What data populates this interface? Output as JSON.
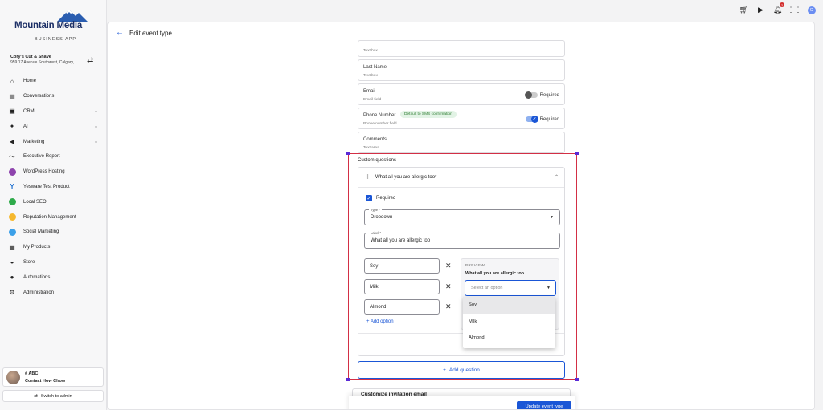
{
  "brand": {
    "name": "Mountain Media",
    "subtitle": "BUSINESS APP"
  },
  "business": {
    "name": "Cory's Cut & Shave",
    "address": "959 17 Avenue Southwest, Calgary, ..."
  },
  "nav": [
    {
      "label": "Home",
      "icon": "home-icon"
    },
    {
      "label": "Conversations",
      "icon": "chat-icon"
    },
    {
      "label": "CRM",
      "icon": "contacts-icon",
      "expandable": true
    },
    {
      "label": "AI",
      "icon": "sparkle-icon",
      "expandable": true
    },
    {
      "label": "Marketing",
      "icon": "megaphone-icon",
      "expandable": true
    },
    {
      "label": "Executive Report",
      "icon": "trend-icon"
    },
    {
      "label": "WordPress Hosting",
      "icon": "wordpress-icon",
      "color": "#8e44ad"
    },
    {
      "label": "Yesware Test Product",
      "icon": "yesware-icon",
      "color": "#1e6fd0"
    },
    {
      "label": "Local SEO",
      "icon": "seo-icon",
      "color": "#2eaa4a"
    },
    {
      "label": "Reputation Management",
      "icon": "star-icon",
      "color": "#f5b82e"
    },
    {
      "label": "Social Marketing",
      "icon": "social-icon",
      "color": "#3ca0e8"
    },
    {
      "label": "My Products",
      "icon": "grid-icon"
    },
    {
      "label": "Store",
      "icon": "basket-icon"
    },
    {
      "label": "Automations",
      "icon": "bolt-icon"
    },
    {
      "label": "Administration",
      "icon": "gear-icon"
    }
  ],
  "contact_card": {
    "line1": "# ABC",
    "line2": "Contact How Chow"
  },
  "switch_admin": "Switch to admin",
  "topbar": {
    "notification_count": "2",
    "user_initial": "C"
  },
  "header": {
    "title": "Edit event type"
  },
  "fields": {
    "textbox_top_sub": "Text box",
    "last_name": {
      "label": "Last Name",
      "sub": "Text box"
    },
    "email": {
      "label": "Email",
      "sub": "Email field",
      "required": "Required"
    },
    "phone": {
      "label": "Phone Number",
      "chip": "Default to SMS confirmation",
      "sub": "Phone number field",
      "required": "Required"
    },
    "comments": {
      "label": "Comments",
      "sub": "Text area"
    }
  },
  "custom_questions": {
    "title": "Custom questions",
    "question_title": "What all you are allergic too*",
    "required_label": "Required",
    "type_label": "Type *",
    "type_value": "Dropdown",
    "label_label": "Label *",
    "label_value": "What all you are allergic too",
    "options": [
      "Soy",
      "Milk",
      "Almond"
    ],
    "add_option": "Add option",
    "preview": {
      "heading": "PREVIEW",
      "question": "What all you are allergic too",
      "placeholder": "Select an option"
    },
    "dropdown_items": [
      "Soy",
      "Milk",
      "Almond"
    ]
  },
  "add_question": "Add question",
  "next_section": "Customize invitation email",
  "update_button": "Update event type",
  "colors": {
    "accent": "#1a56d6",
    "selection": "#d32f45"
  }
}
